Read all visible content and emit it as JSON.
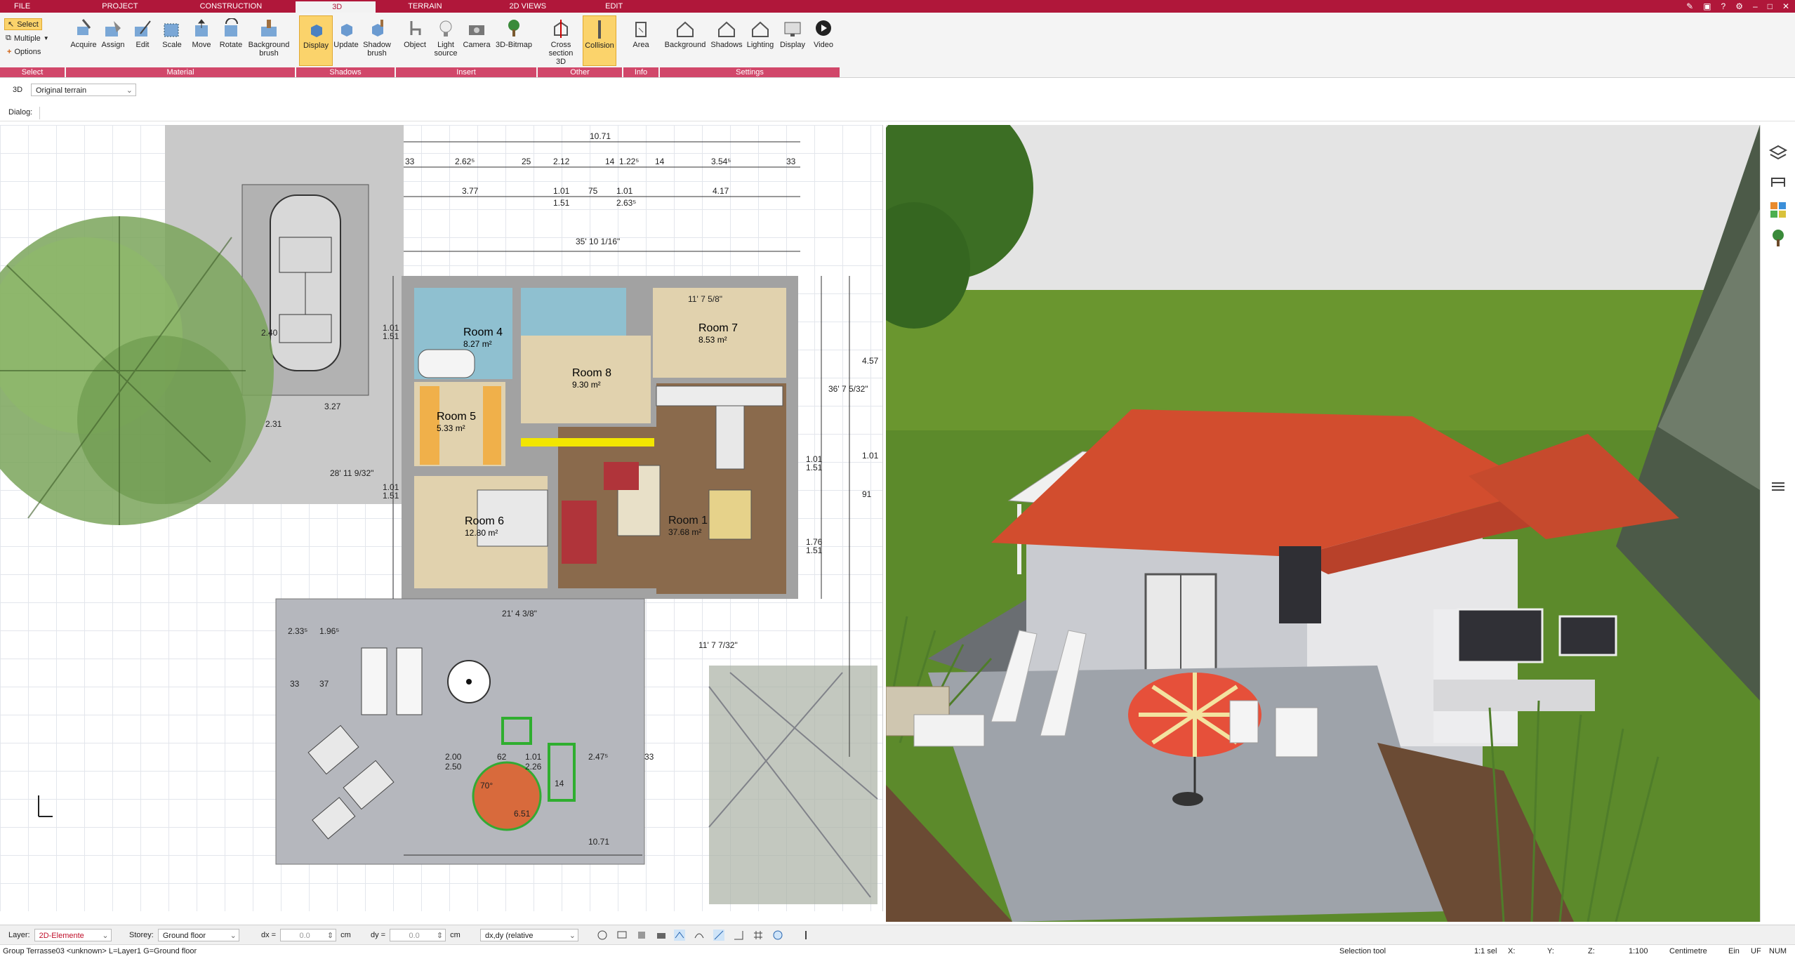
{
  "menu": {
    "tabs": [
      "FILE",
      "PROJECT",
      "CONSTRUCTION",
      "3D",
      "TERRAIN",
      "2D VIEWS",
      "EDIT"
    ],
    "active": "3D"
  },
  "ribbon": {
    "select_group": {
      "select": "Select",
      "multiple": "Multiple",
      "options": "Options",
      "label": "Select"
    },
    "material_group": {
      "label": "Material",
      "buttons": [
        "Acquire",
        "Assign",
        "Edit",
        "Scale",
        "Move",
        "Rotate",
        "Background brush"
      ]
    },
    "shadows_group": {
      "label": "Shadows",
      "buttons": [
        "Display",
        "Update",
        "Shadow brush"
      ]
    },
    "insert_group": {
      "label": "Insert",
      "buttons": [
        "Object",
        "Light source",
        "Camera",
        "3D-Bitmap"
      ]
    },
    "other_group": {
      "label": "Other",
      "buttons": [
        "Cross section 3D",
        "Collision"
      ]
    },
    "info_group": {
      "label": "Info",
      "buttons": [
        "Area"
      ]
    },
    "settings_group": {
      "label": "Settings",
      "buttons": [
        "Background",
        "Shadows",
        "Lighting",
        "Display",
        "Video"
      ]
    }
  },
  "bar3d": {
    "tag": "3D",
    "terrain": "Original terrain"
  },
  "dialog": {
    "label": "Dialog:"
  },
  "plan": {
    "rooms": [
      {
        "name": "Room 4",
        "area": "8.27 m²"
      },
      {
        "name": "Room 7",
        "area": "8.53 m²"
      },
      {
        "name": "Room 8",
        "area": "9.30 m²"
      },
      {
        "name": "Room 5",
        "area": "5.33 m²"
      },
      {
        "name": "Room 6",
        "area": "12.80 m²"
      },
      {
        "name": "Room 1",
        "area": "37.68 m²"
      }
    ],
    "dimensions": {
      "top_total": "10.71",
      "top_row1": [
        "33",
        "2.62⁵",
        "25",
        "2.12",
        "14",
        "1.22⁵",
        "14",
        "3.54⁵",
        "33"
      ],
      "top_row2": [
        "3.77",
        "1.01",
        "75",
        "1.01",
        "4.17"
      ],
      "top_row2b": [
        "1.51",
        "2.63⁵"
      ],
      "bottom_total": "10.71",
      "terrace_row": [
        "2.00",
        "62",
        "1.01",
        "2.47⁵",
        "33"
      ],
      "terrace_row2": [
        "2.50",
        "2.26"
      ],
      "left": [
        "1.01",
        "1.51",
        "2.40",
        "3.27",
        "2.31",
        "1.01",
        "1.51"
      ],
      "right": [
        "4.57",
        "1.01",
        "1.51",
        "1.01",
        "91",
        "1.76",
        "1.51"
      ],
      "terrace_vertical": [
        "2.33⁵",
        "1.96⁵",
        "33",
        "37"
      ],
      "misc": [
        "21' 4 3/8\"",
        "11' 7 5/8\"",
        "11' 7 7/32\"",
        "28' 11 9/32\"",
        "36' 7 5/32\"",
        "35' 10 1/16\""
      ],
      "terrace_area": "6.51",
      "terrace_small": "14",
      "terrace_deg": "70°"
    }
  },
  "layerbar": {
    "layer_label": "Layer:",
    "layer_value": "2D-Elemente",
    "storey_label": "Storey:",
    "storey_value": "Ground floor",
    "dx_label": "dx =",
    "dx_value": "0.0",
    "dx_unit": "cm",
    "dy_label": "dy =",
    "dy_value": "0.0",
    "dy_unit": "cm",
    "coord_mode": "dx,dy (relative cartesian)"
  },
  "status": {
    "left": "Group Terrasse03 <unknown> L=Layer1 G=Ground floor",
    "tool": "Selection tool",
    "sel": "1:1 sel",
    "x": "X:",
    "y": "Y:",
    "z": "Z:",
    "scale": "1:100",
    "unit": "Centimetre",
    "ein": "Ein",
    "uf": "UF",
    "num": "NUM"
  },
  "colors": {
    "brand": "#b0173a",
    "ribbon_label": "#d1476a",
    "active_button": "#fbd36b",
    "roof": "#d24d2e",
    "grass": "#5c8a2b"
  }
}
